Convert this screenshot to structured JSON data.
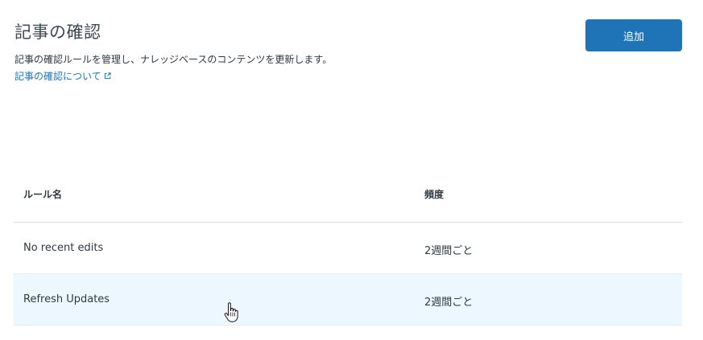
{
  "header": {
    "title": "記事の確認",
    "description": "記事の確認ルールを管理し、ナレッジベースのコンテンツを更新します。",
    "learn_more_link": "記事の確認について",
    "add_button_label": "追加"
  },
  "table": {
    "columns": [
      "ルール名",
      "頻度"
    ],
    "rows": [
      {
        "name": "No recent edits",
        "frequency": "2週間ごと"
      },
      {
        "name": "Refresh Updates",
        "frequency": "2週間ごと"
      }
    ]
  },
  "icons": {
    "external_link": "external-link-icon",
    "cursor": "hand-pointer-icon"
  },
  "colors": {
    "accent": "#1f73b7",
    "row_hover": "#edf7ff",
    "divider": "#d8dcde"
  }
}
